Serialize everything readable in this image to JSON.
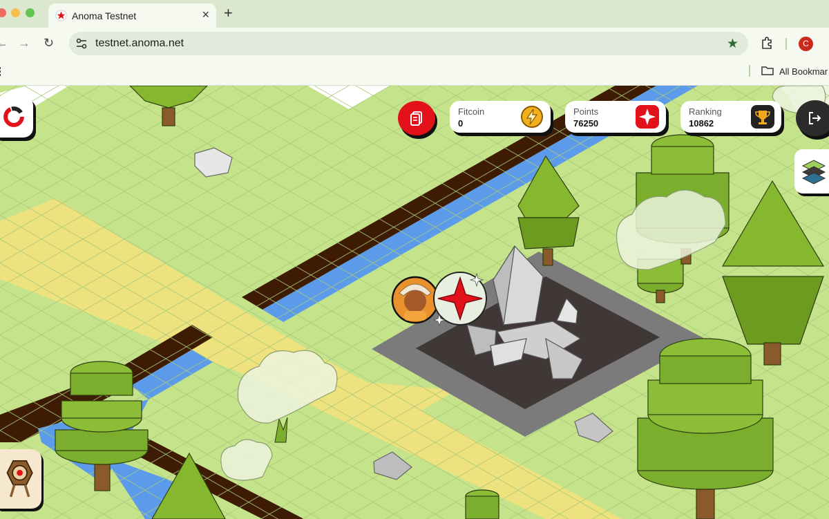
{
  "browser": {
    "tab_title": "Anoma Testnet",
    "url": "testnet.anoma.net",
    "avatar_letter": "C",
    "bookmarks_label": "All Bookmarks",
    "bookmarks_visible": "All Bookmar"
  },
  "hud": {
    "fitcoin": {
      "label": "Fitcoin",
      "value": "0",
      "icon": "lightning-coin-icon"
    },
    "points": {
      "label": "Points",
      "value": "76250",
      "icon": "sparkle-icon"
    },
    "ranking": {
      "label": "Ranking",
      "value": "10862",
      "icon": "trophy-icon"
    }
  },
  "buttons": {
    "inventory": "inventory-icon",
    "logout": "logout-icon",
    "logo": "anoma-logo-icon",
    "map": "map-icon",
    "tool": "target-tool-icon"
  },
  "colors": {
    "grass": "#c5e38a",
    "path": "#ede27d",
    "water": "#5b9bea",
    "trench": "#3e1c04",
    "accent_red": "#e3121a",
    "tree": "#7cae2e"
  }
}
